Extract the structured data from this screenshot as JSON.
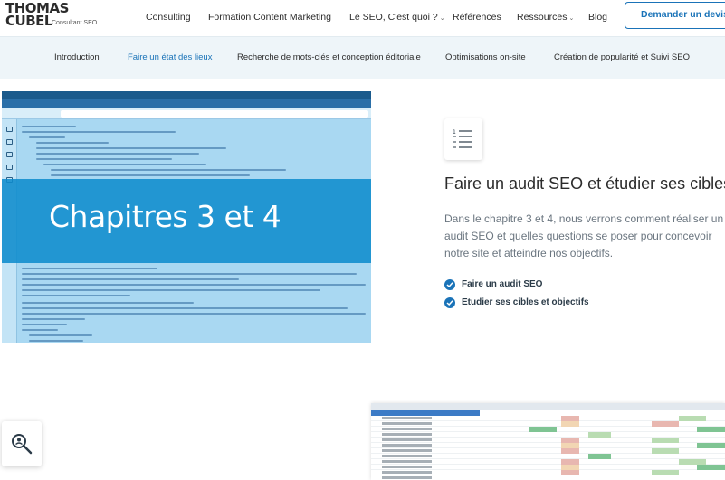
{
  "brand": {
    "line1": "THOMAS",
    "line2": "CUBEL",
    "tagline": "Consultant SEO"
  },
  "nav": {
    "items": [
      {
        "label": "Consulting",
        "dropdown": false
      },
      {
        "label": "Formation Content Marketing",
        "dropdown": false
      },
      {
        "label": "Le SEO, C'est quoi ?",
        "dropdown": true
      },
      {
        "label": "Références",
        "dropdown": false
      },
      {
        "label": "Ressources",
        "dropdown": true
      },
      {
        "label": "Blog",
        "dropdown": false
      }
    ],
    "cta_label": "Demander un devis"
  },
  "subnav": {
    "items": [
      {
        "label": "Introduction",
        "active": false
      },
      {
        "label": "Faire un état des lieux",
        "active": true
      },
      {
        "label": "Recherche de mots-clés et conception éditoriale",
        "active": false
      },
      {
        "label": "Optimisations on-site",
        "active": false
      },
      {
        "label": "Création de popularité et Suivi SEO",
        "active": false
      }
    ]
  },
  "hero_image": {
    "overlay_text": "Chapitres 3 et 4"
  },
  "section": {
    "icon": "list-icon",
    "title": "Faire un audit SEO et étudier ses cibles",
    "paragraph": "Dans le chapitre 3 et 4, nous verrons comment réaliser un audit SEO et quelles questions se poser pour concevoir notre site et atteindre nos objectifs.",
    "checklist": [
      {
        "label": "Faire un audit SEO",
        "icon": "check-circle-icon"
      },
      {
        "label": "Etudier ses cibles et objectifs",
        "icon": "check-circle-icon"
      }
    ]
  },
  "widgets": {
    "search_icon": "search-zoom-icon"
  },
  "colors": {
    "accent": "#1a73b8",
    "overlay": "#0f8ccd",
    "subnav_bg": "#eef5f9"
  }
}
